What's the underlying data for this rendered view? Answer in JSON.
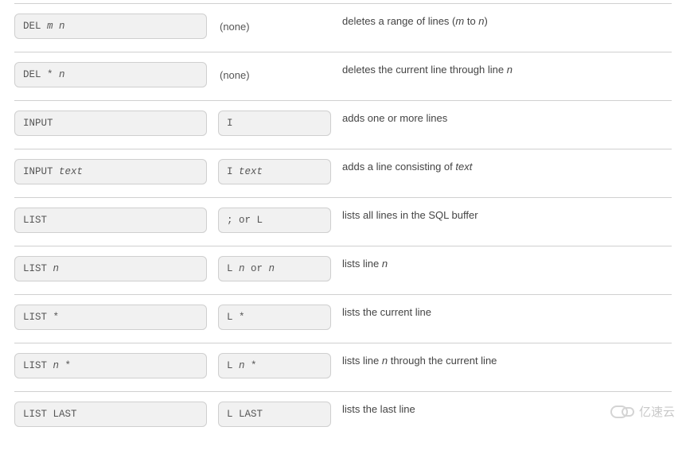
{
  "rows": [
    {
      "cmd_segments": [
        {
          "t": "DEL ",
          "em": false
        },
        {
          "t": "m n",
          "em": true
        }
      ],
      "abbr_type": "none",
      "abbr_text": "(none)",
      "desc_segments": [
        {
          "t": "deletes a range of lines (",
          "em": false
        },
        {
          "t": "m",
          "em": true
        },
        {
          "t": " to ",
          "em": false
        },
        {
          "t": "n",
          "em": true
        },
        {
          "t": ")",
          "em": false
        }
      ]
    },
    {
      "cmd_segments": [
        {
          "t": "DEL * ",
          "em": false
        },
        {
          "t": "n",
          "em": true
        }
      ],
      "abbr_type": "none",
      "abbr_text": "(none)",
      "desc_segments": [
        {
          "t": "deletes the current line through line ",
          "em": false
        },
        {
          "t": "n",
          "em": true
        }
      ]
    },
    {
      "cmd_segments": [
        {
          "t": "INPUT",
          "em": false
        }
      ],
      "abbr_type": "code",
      "abbr_segments": [
        {
          "t": "I",
          "em": false
        }
      ],
      "desc_segments": [
        {
          "t": "adds one or more lines",
          "em": false
        }
      ]
    },
    {
      "cmd_segments": [
        {
          "t": "INPUT ",
          "em": false
        },
        {
          "t": "text",
          "em": true
        }
      ],
      "abbr_type": "code",
      "abbr_segments": [
        {
          "t": "I ",
          "em": false
        },
        {
          "t": "text",
          "em": true
        }
      ],
      "desc_segments": [
        {
          "t": "adds a line consisting of ",
          "em": false
        },
        {
          "t": "text",
          "em": true
        }
      ]
    },
    {
      "cmd_segments": [
        {
          "t": "LIST",
          "em": false
        }
      ],
      "abbr_type": "code",
      "abbr_segments": [
        {
          "t": "; or L",
          "em": false
        }
      ],
      "desc_segments": [
        {
          "t": "lists all lines in the SQL buffer",
          "em": false
        }
      ]
    },
    {
      "cmd_segments": [
        {
          "t": "LIST ",
          "em": false
        },
        {
          "t": "n",
          "em": true
        }
      ],
      "abbr_type": "code",
      "abbr_segments": [
        {
          "t": "L ",
          "em": false
        },
        {
          "t": "n",
          "em": true
        },
        {
          "t": " or ",
          "em": false
        },
        {
          "t": "n",
          "em": true
        }
      ],
      "desc_segments": [
        {
          "t": "lists line ",
          "em": false
        },
        {
          "t": "n",
          "em": true
        }
      ]
    },
    {
      "cmd_segments": [
        {
          "t": "LIST *",
          "em": false
        }
      ],
      "abbr_type": "code",
      "abbr_segments": [
        {
          "t": "L *",
          "em": false
        }
      ],
      "desc_segments": [
        {
          "t": "lists the current line",
          "em": false
        }
      ]
    },
    {
      "cmd_segments": [
        {
          "t": "LIST ",
          "em": false
        },
        {
          "t": "n",
          "em": true
        },
        {
          "t": " *",
          "em": false
        }
      ],
      "abbr_type": "code",
      "abbr_segments": [
        {
          "t": "L ",
          "em": false
        },
        {
          "t": "n",
          "em": true
        },
        {
          "t": " *",
          "em": false
        }
      ],
      "desc_segments": [
        {
          "t": "lists line ",
          "em": false
        },
        {
          "t": "n",
          "em": true
        },
        {
          "t": " through the current line",
          "em": false
        }
      ]
    },
    {
      "cmd_segments": [
        {
          "t": "LIST LAST",
          "em": false
        }
      ],
      "abbr_type": "code",
      "abbr_segments": [
        {
          "t": "L LAST",
          "em": false
        }
      ],
      "desc_segments": [
        {
          "t": "lists the last line",
          "em": false
        }
      ]
    }
  ],
  "watermark": "亿速云"
}
